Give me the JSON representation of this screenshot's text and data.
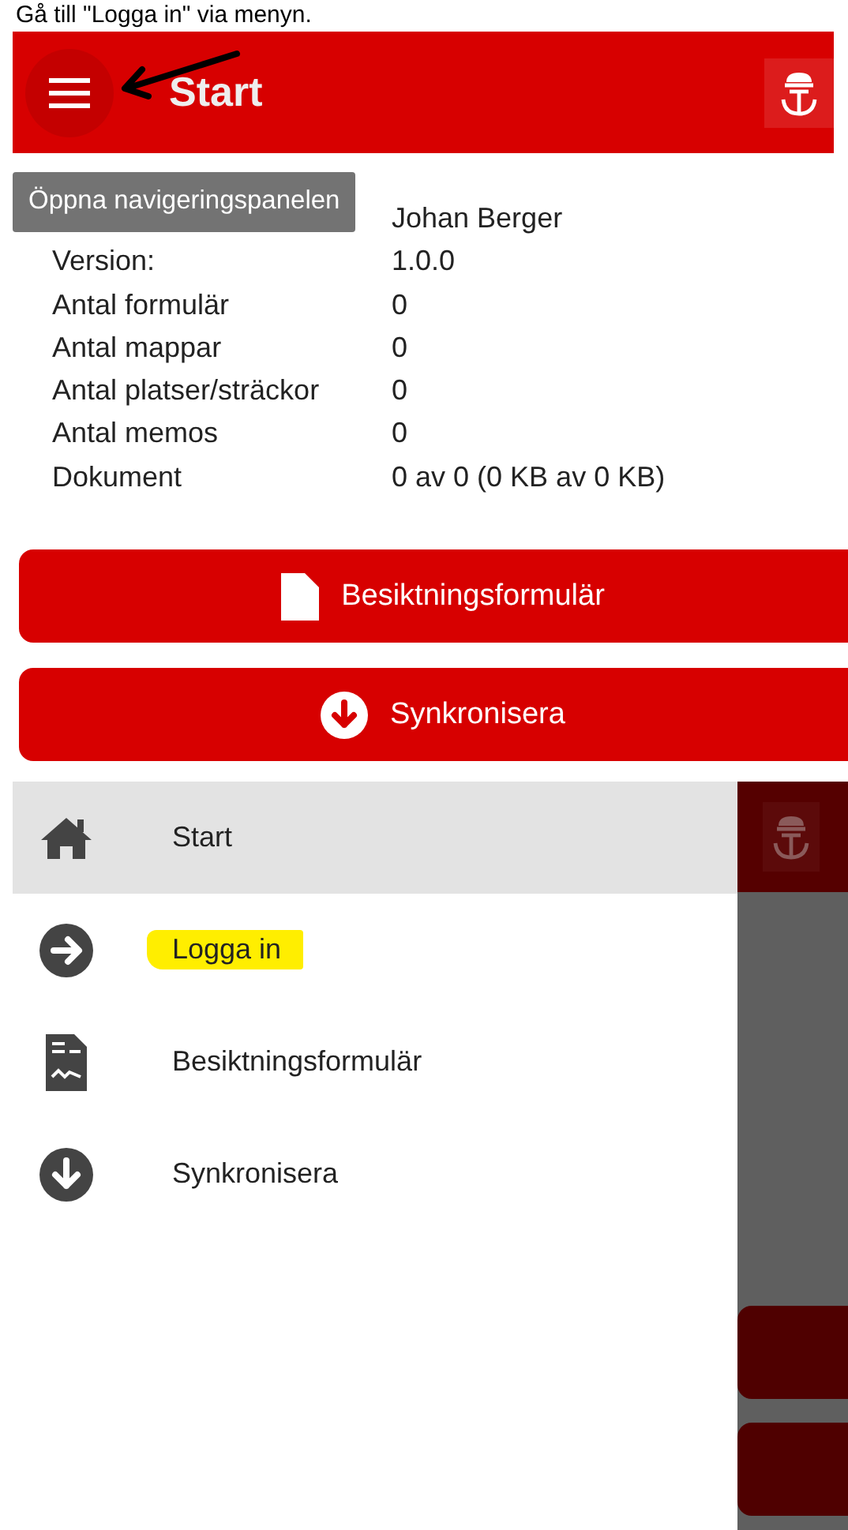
{
  "caption": "Gå till \"Logga in\" via menyn.",
  "screen_1": {
    "app_bar": {
      "title": "Start"
    },
    "tooltip": "Öppna navigeringspanelen",
    "info": [
      {
        "value": "Johan Berger"
      },
      {
        "label": "Version:",
        "value": "1.0.0"
      },
      {
        "label": "Antal formulär",
        "value": "0"
      },
      {
        "label": "Antal mappar",
        "value": "0"
      },
      {
        "label": "Antal platser/sträckor",
        "value": "0"
      },
      {
        "label": "Antal memos",
        "value": "0"
      },
      {
        "label": "Dokument",
        "value": "0 av 0 (0 KB av 0 KB)"
      }
    ],
    "buttons": [
      {
        "label": "Besiktningsformulär"
      },
      {
        "label": "Synkronisera"
      }
    ]
  },
  "screen_2": {
    "drawer": {
      "items": [
        {
          "label": "Start",
          "selected": true,
          "highlighted": false
        },
        {
          "label": "Logga in",
          "selected": false,
          "highlighted": true
        },
        {
          "label": "Besiktningsformulär",
          "selected": false,
          "highlighted": false
        },
        {
          "label": "Synkronisera",
          "selected": false,
          "highlighted": false
        }
      ]
    }
  }
}
